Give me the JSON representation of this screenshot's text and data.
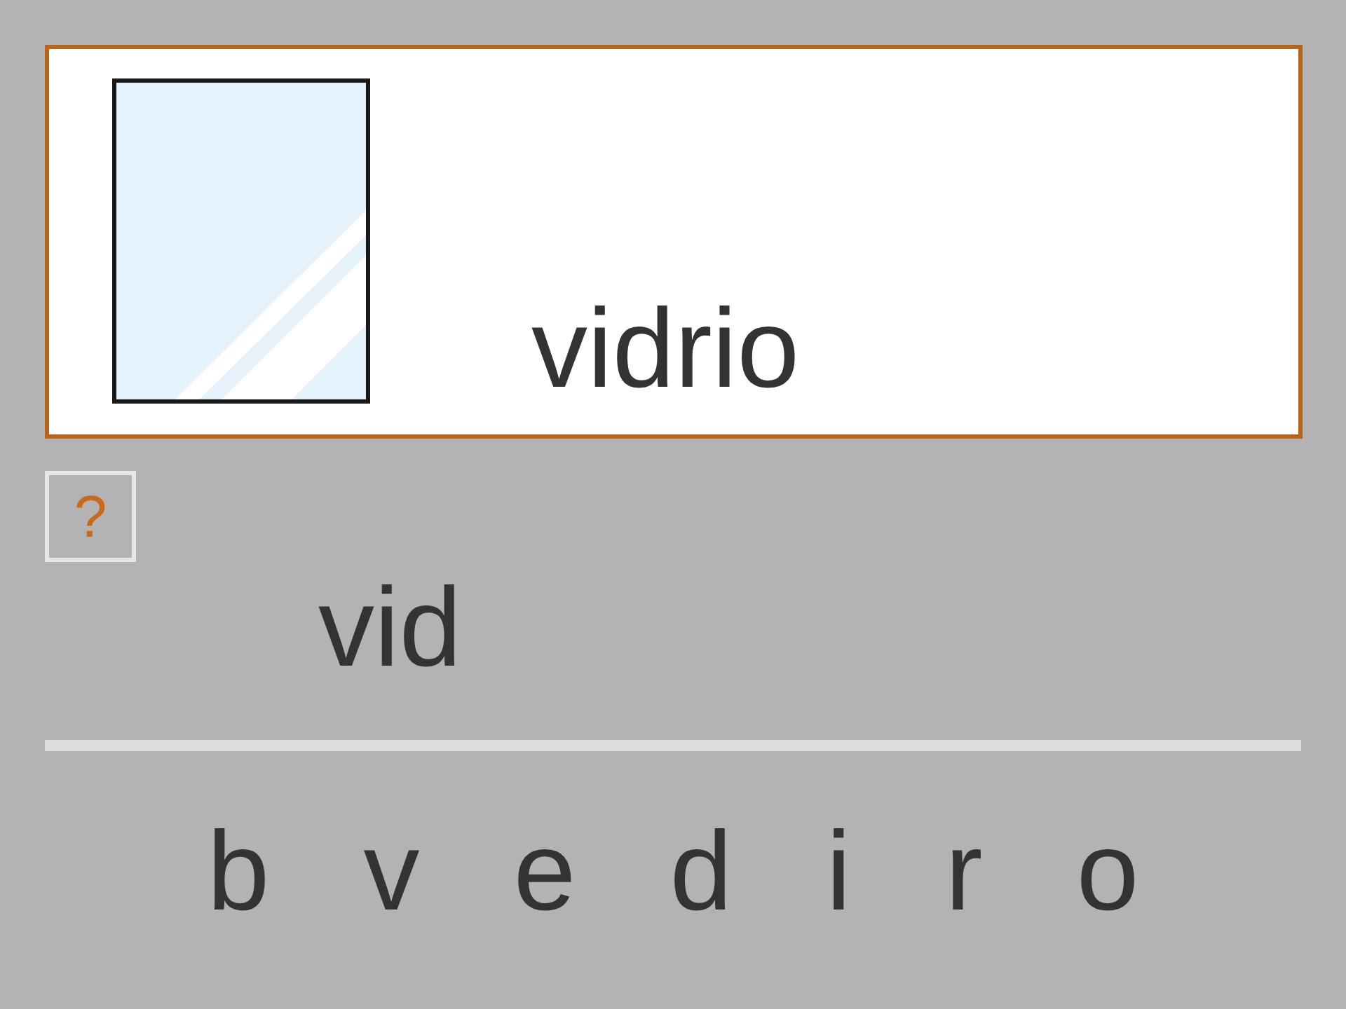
{
  "card": {
    "word": "vidrio"
  },
  "help_button": {
    "label": "?"
  },
  "answer": {
    "value": "vid"
  },
  "letters": [
    "b",
    "v",
    "e",
    "d",
    "i",
    "r",
    "o"
  ]
}
